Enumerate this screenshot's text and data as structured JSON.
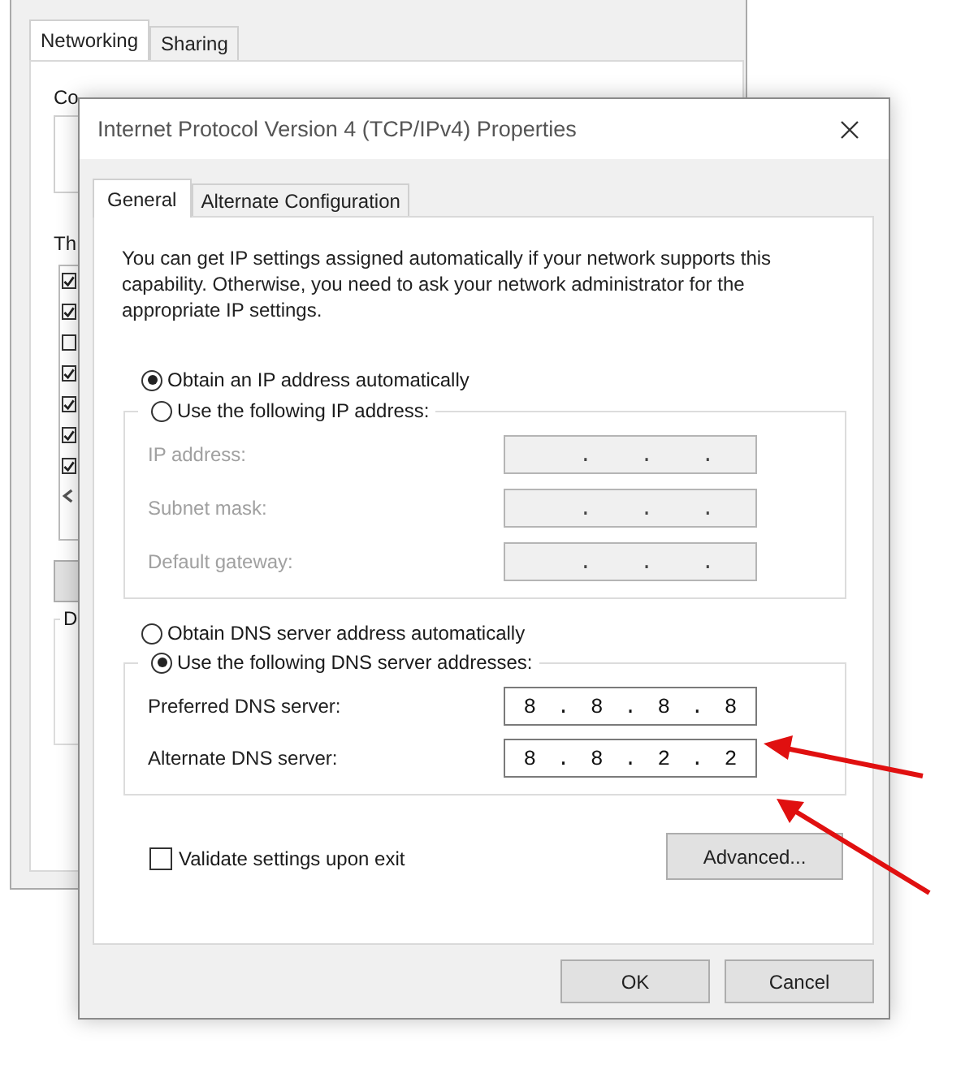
{
  "background_window": {
    "tabs": [
      {
        "label": "Networking",
        "selected": true
      },
      {
        "label": "Sharing",
        "selected": false
      }
    ],
    "connect_label": "Co",
    "list_label": "Th",
    "components": [
      {
        "checked": true
      },
      {
        "checked": true
      },
      {
        "checked": false
      },
      {
        "checked": true
      },
      {
        "checked": true
      },
      {
        "checked": true
      },
      {
        "checked": true
      }
    ],
    "group_label": "D"
  },
  "dialog": {
    "title": "Internet Protocol Version 4 (TCP/IPv4) Properties",
    "tabs": [
      {
        "label": "General",
        "selected": true
      },
      {
        "label": "Alternate Configuration",
        "selected": false
      }
    ],
    "description": "You can get IP settings assigned automatically if your network supports this capability. Otherwise, you need to ask your network administrator for the appropriate IP settings.",
    "ip_auto": {
      "label": "Obtain an IP address automatically",
      "selected": true
    },
    "ip_manual": {
      "label": "Use the following IP address:",
      "selected": false
    },
    "ip_fields": [
      {
        "label": "IP address:",
        "value": ". . .",
        "disabled": true
      },
      {
        "label": "Subnet mask:",
        "value": ". . .",
        "disabled": true
      },
      {
        "label": "Default gateway:",
        "value": ". . .",
        "disabled": true
      }
    ],
    "dns_auto": {
      "label": "Obtain DNS server address automatically",
      "selected": false
    },
    "dns_manual": {
      "label": "Use the following DNS server addresses:",
      "selected": true
    },
    "dns_fields": [
      {
        "label": "Preferred DNS server:",
        "value": "8 . 8 . 8 . 8",
        "disabled": false
      },
      {
        "label": "Alternate DNS server:",
        "value": "8 . 8 . 2 . 2",
        "disabled": false
      }
    ],
    "validate": {
      "label": "Validate settings upon exit",
      "checked": false
    },
    "advanced_button": "Advanced...",
    "buttons": [
      "OK",
      "Cancel"
    ]
  }
}
